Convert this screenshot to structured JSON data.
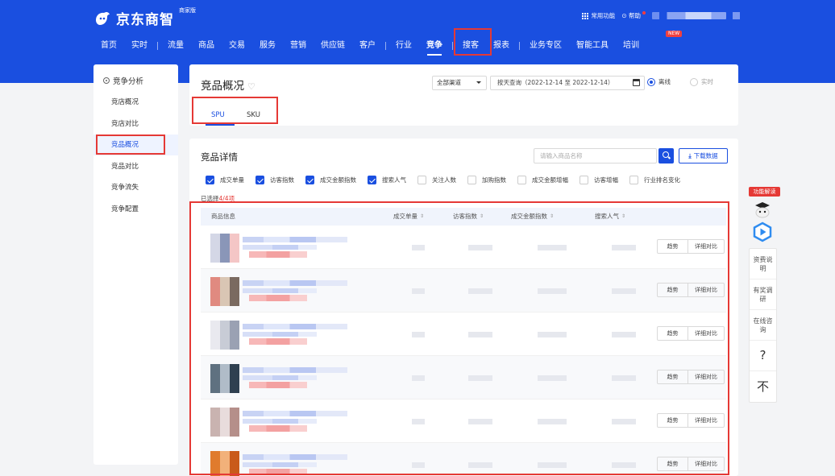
{
  "header": {
    "logo_text": "京东商智",
    "logo_badge": "商家版",
    "tools_label": "常用功能",
    "help_label": "帮助",
    "new_badge": "NEW"
  },
  "nav": [
    {
      "label": "首页"
    },
    {
      "label": "实时"
    },
    {
      "sep": true
    },
    {
      "label": "流量"
    },
    {
      "label": "商品"
    },
    {
      "label": "交易"
    },
    {
      "label": "服务"
    },
    {
      "label": "营销"
    },
    {
      "label": "供应链"
    },
    {
      "label": "客户"
    },
    {
      "sep": true
    },
    {
      "label": "行业"
    },
    {
      "label": "竞争",
      "active": true
    },
    {
      "sep": true
    },
    {
      "label": "搜客"
    },
    {
      "label": "报表"
    },
    {
      "sep": true
    },
    {
      "label": "业务专区"
    },
    {
      "label": "智能工具"
    },
    {
      "label": "培训"
    }
  ],
  "sidebar": {
    "title": "竞争分析",
    "items": [
      {
        "label": "竞店概况"
      },
      {
        "label": "竞店对比"
      },
      {
        "label": "竞品概况",
        "active": true
      },
      {
        "label": "竞品对比"
      },
      {
        "label": "竞争流失"
      },
      {
        "label": "竞争配置"
      }
    ]
  },
  "overview": {
    "title": "竞品概况",
    "channel": "全部渠道",
    "date_range": "按天查询（2022-12-14 至 2022-12-14）",
    "radio_offline": "离线",
    "radio_realtime": "实时",
    "tabs": [
      "SPU",
      "SKU"
    ]
  },
  "detail": {
    "title": "竞品详情",
    "search_placeholder": "请输入商品名称",
    "download_label": "下载数据",
    "metrics": [
      {
        "label": "成交单量",
        "checked": true
      },
      {
        "label": "访客指数",
        "checked": true
      },
      {
        "label": "成交金额指数",
        "checked": true
      },
      {
        "label": "搜索人气",
        "checked": true
      },
      {
        "label": "关注人数",
        "checked": false
      },
      {
        "label": "加购指数",
        "checked": false
      },
      {
        "label": "成交金额增幅",
        "checked": false
      },
      {
        "label": "访客增幅",
        "checked": false
      },
      {
        "label": "行业排名变化",
        "checked": false
      }
    ],
    "selected_prefix": "已选择",
    "selected_count": "4",
    "selected_suffix": "/4项",
    "columns": [
      "商品信息",
      "成交单量",
      "访客指数",
      "成交金额指数",
      "搜索人气"
    ],
    "sort_glyph": "⇕",
    "trend_label": "趋势",
    "compare_label": "详细对比"
  },
  "right_panel": {
    "badge": "功能解读",
    "items": [
      "资费说明",
      "有奖调研",
      "在线咨询",
      "?",
      "不"
    ]
  },
  "colors": {
    "brand": "#1a4fe0",
    "highlight": "#e53935"
  }
}
